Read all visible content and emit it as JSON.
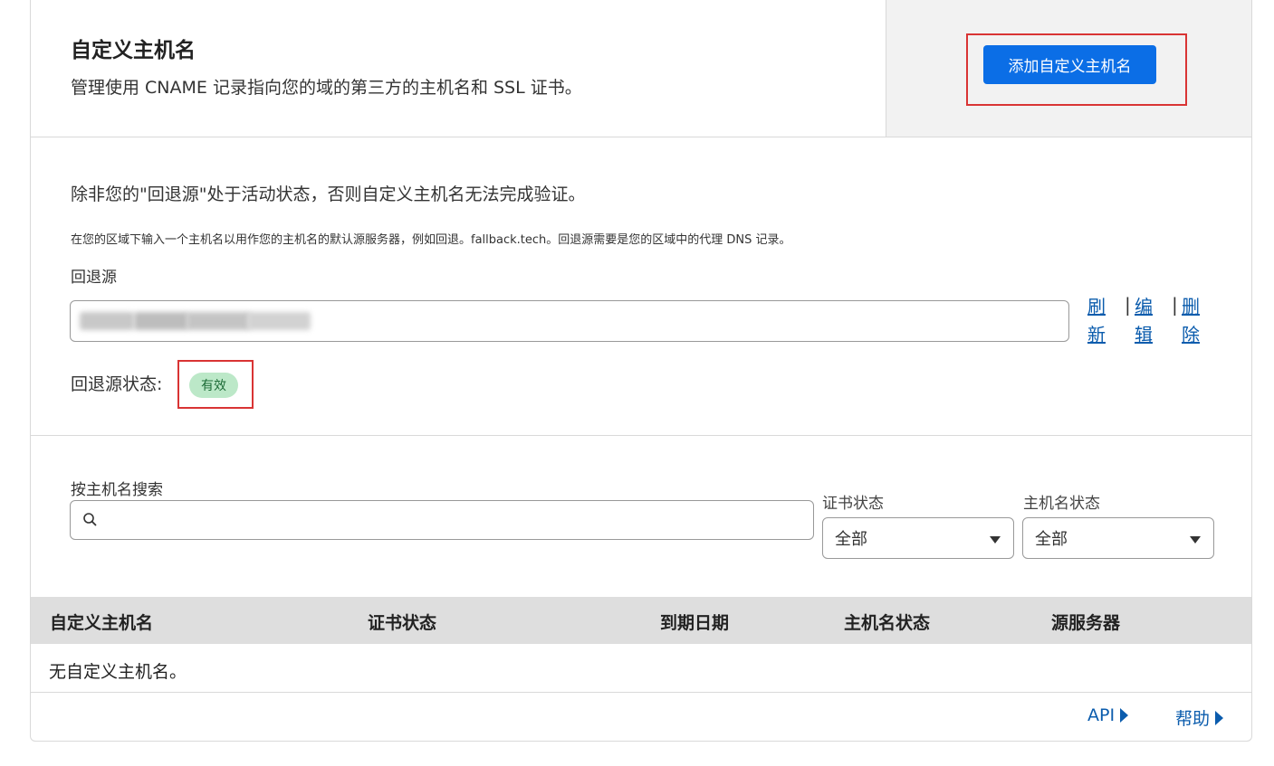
{
  "header": {
    "title": "自定义主机名",
    "subtitle": "管理使用 CNAME 记录指向您的域的第三方的主机名和 SSL 证书。",
    "add_button": "添加自定义主机名"
  },
  "fallback": {
    "heading": "除非您的\"回退源\"处于活动状态，否则自定义主机名无法完成验证。",
    "description": "在您的区域下输入一个主机名以用作您的主机名的默认源服务器，例如回退。fallback.tech。回退源需要是您的区域中的代理 DNS 记录。",
    "label": "回退源",
    "actions": {
      "refresh": "刷新",
      "edit": "编辑",
      "delete": "删除"
    },
    "status_label": "回退源状态:",
    "status_value": "有效",
    "status_color": "#bce8c8"
  },
  "filters": {
    "search_label": "按主机名搜索",
    "cert_status_label": "证书状态",
    "cert_status_value": "全部",
    "host_status_label": "主机名状态",
    "host_status_value": "全部"
  },
  "table": {
    "columns": [
      "自定义主机名",
      "证书状态",
      "到期日期",
      "主机名状态",
      "源服务器"
    ],
    "empty_text": "无自定义主机名。"
  },
  "footer": {
    "api_link": "API",
    "help_link": "帮助"
  },
  "colors": {
    "accent": "#0b6ee6",
    "link": "#0b5cad",
    "highlight_border": "#d93434"
  }
}
